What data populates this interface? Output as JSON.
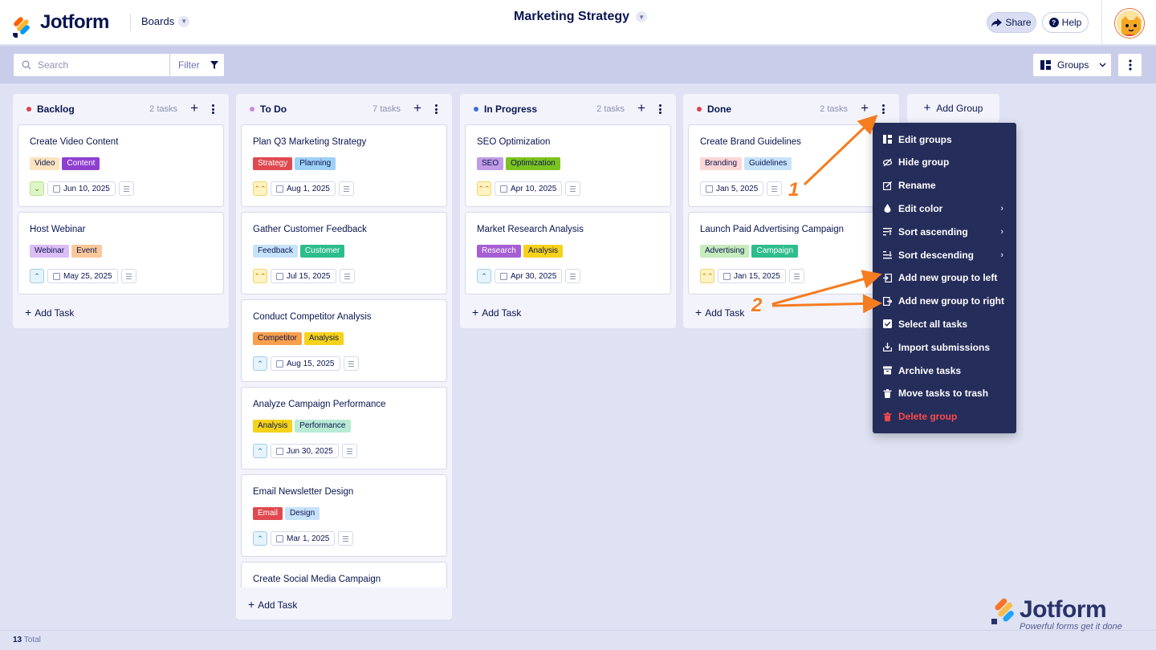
{
  "header": {
    "brand": "Jotform",
    "boards_label": "Boards",
    "title": "Marketing Strategy",
    "share_label": "Share",
    "help_label": "Help"
  },
  "toolbar": {
    "search_placeholder": "Search",
    "filter_label": "Filter",
    "groups_label": "Groups"
  },
  "columns": [
    {
      "title": "Backlog",
      "count": "2 tasks",
      "color": "#e0404f",
      "add_task": "Add Task",
      "cards": [
        {
          "title": "Create Video Content",
          "tags": [
            {
              "label": "Video",
              "bg": "#fde3c0",
              "fg": "#0a1551"
            },
            {
              "label": "Content",
              "bg": "#8e3fd0",
              "fg": "#ffffff"
            }
          ],
          "priority": "low",
          "date": "Jun 10, 2025"
        },
        {
          "title": "Host Webinar",
          "tags": [
            {
              "label": "Webinar",
              "bg": "#dcbdf5",
              "fg": "#0a1551"
            },
            {
              "label": "Event",
              "bg": "#fbc89a",
              "fg": "#0a1551"
            }
          ],
          "priority": "medium",
          "date": "May 25, 2025"
        }
      ]
    },
    {
      "title": "To Do",
      "count": "7 tasks",
      "color": "#c98ce0",
      "add_task": "Add Task",
      "cards": [
        {
          "title": "Plan Q3 Marketing Strategy",
          "tags": [
            {
              "label": "Strategy",
              "bg": "#e0494f",
              "fg": "#ffffff"
            },
            {
              "label": "Planning",
              "bg": "#9fd0f5",
              "fg": "#0a1551"
            }
          ],
          "priority": "high",
          "date": "Aug 1, 2025"
        },
        {
          "title": "Gather Customer Feedback",
          "tags": [
            {
              "label": "Feedback",
              "bg": "#c7e3fb",
              "fg": "#0a1551"
            },
            {
              "label": "Customer",
              "bg": "#2dbd8c",
              "fg": "#ffffff"
            }
          ],
          "priority": "high",
          "date": "Jul 15, 2025"
        },
        {
          "title": "Conduct Competitor Analysis",
          "tags": [
            {
              "label": "Competitor",
              "bg": "#f8a04c",
              "fg": "#0a1551"
            },
            {
              "label": "Analysis",
              "bg": "#f6d21a",
              "fg": "#0a1551"
            }
          ],
          "priority": "medium",
          "date": "Aug 15, 2025"
        },
        {
          "title": "Analyze Campaign Performance",
          "tags": [
            {
              "label": "Analysis",
              "bg": "#f6d21a",
              "fg": "#0a1551"
            },
            {
              "label": "Performance",
              "bg": "#b8ead4",
              "fg": "#0a1551"
            }
          ],
          "priority": "medium",
          "date": "Jun 30, 2025"
        },
        {
          "title": "Email Newsletter Design",
          "tags": [
            {
              "label": "Email",
              "bg": "#e0494f",
              "fg": "#ffffff"
            },
            {
              "label": "Design",
              "bg": "#c7e3fb",
              "fg": "#0a1551"
            }
          ],
          "priority": "medium",
          "date": "Mar 1, 2025"
        },
        {
          "title": "Create Social Media Campaign",
          "tags": [],
          "priority": "",
          "date": ""
        }
      ]
    },
    {
      "title": "In Progress",
      "count": "2 tasks",
      "color": "#3f6fd6",
      "add_task": "Add Task",
      "cards": [
        {
          "title": "SEO Optimization",
          "tags": [
            {
              "label": "SEO",
              "bg": "#c09be6",
              "fg": "#0a1551"
            },
            {
              "label": "Optimization",
              "bg": "#7cc31f",
              "fg": "#0a1551"
            }
          ],
          "priority": "high",
          "date": "Apr 10, 2025"
        },
        {
          "title": "Market Research Analysis",
          "tags": [
            {
              "label": "Research",
              "bg": "#a65ed4",
              "fg": "#ffffff"
            },
            {
              "label": "Analysis",
              "bg": "#f6d21a",
              "fg": "#0a1551"
            }
          ],
          "priority": "medium",
          "date": "Apr 30, 2025"
        }
      ]
    },
    {
      "title": "Done",
      "count": "2 tasks",
      "color": "#e0404f",
      "add_task": "Add Task",
      "cards": [
        {
          "title": "Create Brand Guidelines",
          "tags": [
            {
              "label": "Branding",
              "bg": "#fcd6d6",
              "fg": "#0a1551"
            },
            {
              "label": "Guidelines",
              "bg": "#c7e3fb",
              "fg": "#0a1551"
            }
          ],
          "priority": "",
          "date": "Jan 5, 2025"
        },
        {
          "title": "Launch Paid Advertising Campaign",
          "tags": [
            {
              "label": "Advertising",
              "bg": "#c6ebbd",
              "fg": "#0a1551"
            },
            {
              "label": "Campaign",
              "bg": "#2dbd8c",
              "fg": "#ffffff"
            }
          ],
          "priority": "high",
          "date": "Jan 15, 2025"
        }
      ]
    }
  ],
  "add_group_label": "Add Group",
  "menu": {
    "items": [
      {
        "label": "Edit groups",
        "icon": "grid-icon"
      },
      {
        "label": "Hide group",
        "icon": "eye-off-icon"
      },
      {
        "label": "Rename",
        "icon": "edit-icon"
      },
      {
        "label": "Edit color",
        "icon": "droplet-icon",
        "submenu": true
      },
      {
        "label": "Sort ascending",
        "icon": "sort-ascending-icon",
        "submenu": true
      },
      {
        "label": "Sort descending",
        "icon": "sort-descending-icon",
        "submenu": true
      },
      {
        "label": "Add new group to left",
        "icon": "insert-left-icon"
      },
      {
        "label": "Add new group to right",
        "icon": "insert-right-icon"
      },
      {
        "label": "Select all tasks",
        "icon": "checkbox-icon"
      },
      {
        "label": "Import submissions",
        "icon": "import-icon"
      },
      {
        "label": "Archive tasks",
        "icon": "archive-icon"
      },
      {
        "label": "Move tasks to trash",
        "icon": "trash-icon"
      },
      {
        "label": "Delete group",
        "icon": "trash-icon",
        "danger": true
      }
    ]
  },
  "footer": {
    "count": "13",
    "label": "Total"
  },
  "watermark": {
    "brand": "Jotform",
    "tagline": "Powerful forms get it done"
  },
  "annotations": {
    "step1": "1",
    "step2": "2"
  },
  "colors": {
    "accent_orange": "#f57c1f",
    "navy": "#0a1551",
    "menu_bg": "#252d5b",
    "danger": "#ff4948"
  }
}
